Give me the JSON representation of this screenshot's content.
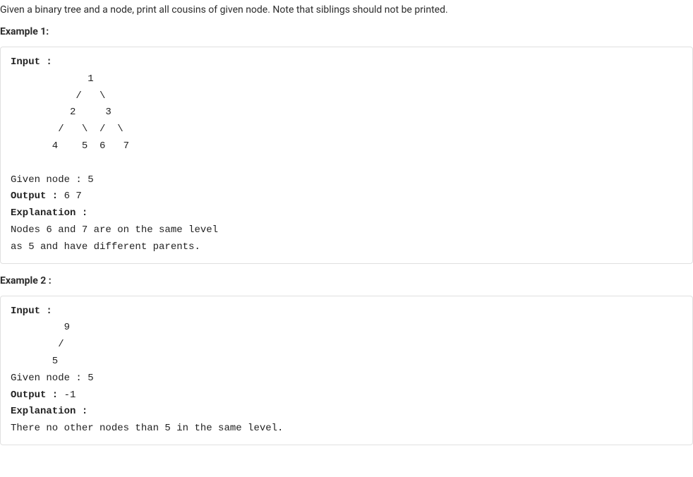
{
  "problem_statement": "Given a binary tree and a node, print all cousins of given node. Note that siblings should not be printed.",
  "example1": {
    "heading": "Example 1:",
    "input_label": "Input :",
    "tree_line1": "             1",
    "tree_line2": "           /   \\",
    "tree_line3": "          2     3",
    "tree_line4": "        /   \\  /  \\",
    "tree_line5": "       4    5  6   7",
    "given_node": "Given node : 5",
    "output_label": "Output :",
    "output_value": " 6 7",
    "explanation_label": "Explanation :",
    "explanation_line1": "Nodes 6 and 7 are on the same level ",
    "explanation_line2": "as 5 and have different parents."
  },
  "example2": {
    "heading": "Example 2 :",
    "input_label": "Input :",
    "tree_line1": "         9",
    "tree_line2": "        /",
    "tree_line3": "       5",
    "given_node": "Given node : 5",
    "output_label": "Output :",
    "output_value": " -1",
    "explanation_label": "Explanation :",
    "explanation_line1": "There no other nodes than 5 in the same level."
  }
}
